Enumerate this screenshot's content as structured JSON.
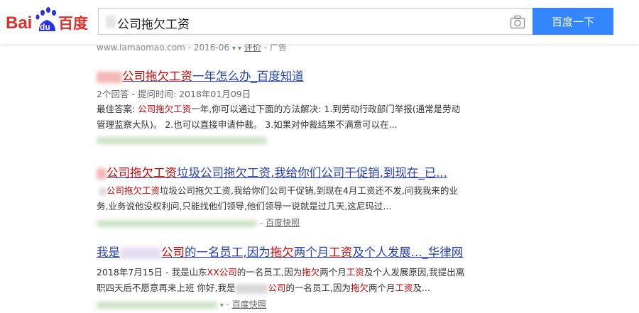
{
  "header": {
    "logo_bai": "Bai",
    "logo_du": "du",
    "logo_cn": "百度",
    "query": "公司拖欠工资",
    "search_button": "百度一下"
  },
  "prev_result": {
    "url": "www.lamaomao.com",
    "date": "- 2016-06",
    "arrows": "▾ ▾",
    "link": "评价",
    "tail": "- 广告"
  },
  "results": [
    {
      "title_hl": "公司拖欠工资",
      "title_rest": "一年怎么办_百度知道",
      "meta": "2个回答 - 提问时间: 2018年01月09日",
      "line1_prefix": "最佳答案: ",
      "line1_hl": "公司拖欠工资",
      "line1_rest": "一年,你可以通过下面的方法解决: 1.到劳动行政部门举报(通常是劳动",
      "line2": "管理监察大队)。 2.也可以直接申请仲裁。 3.如果对仲裁结果不满意可以在..."
    },
    {
      "title_hl": "公司拖欠工资",
      "title_rest": "垃圾公司拖欠工资,我给你们公司干促销,到现在_已...",
      "line1_hl": "公司拖欠工资",
      "line1_rest": "垃圾公司拖欠工资,我给你们公司干促销,到现在4月工资还不发,问我我来的业",
      "line2": "务,业务说他没权利问,只能找他们领导,他们领导一说就是过几天,这尼玛过...",
      "kuaizhao": "百度快照",
      "sep": "-"
    },
    {
      "title_a": "我是",
      "title_hl1": "公司",
      "title_b": "的一名员工,因为",
      "title_hl2": "拖欠",
      "title_c": "两个月",
      "title_hl3": "工资",
      "title_d": "及个人发展..._华律网",
      "line1_date": "2018年7月15日 - 我是山东",
      "line1_hl1": "XX公司",
      "line1_a": "的一名员工,因为",
      "line1_hl2": "拖欠",
      "line1_b": "两个月",
      "line1_hl3": "工资",
      "line1_c": "及个人发展原因,我提出离",
      "line2_a": "职四天后不愿意再来上班 你好,我是",
      "line2_hl1": "公司",
      "line2_b": "的一名员工,因为",
      "line2_hl2": "拖欠",
      "line2_c": "两个月",
      "line2_hl3": "工资",
      "line2_d": "及...",
      "kuaizhao": "百度快照",
      "sep": "-"
    }
  ],
  "colors": {
    "link": "#2440b3",
    "highlight": "#c00000",
    "button": "#3385ff",
    "logo_red": "#de2e27",
    "logo_blue": "#2932e1"
  }
}
